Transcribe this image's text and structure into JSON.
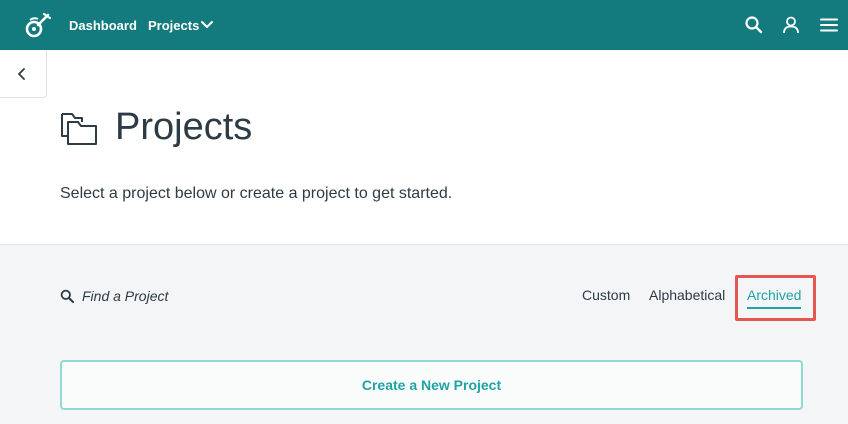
{
  "topbar": {
    "bg_color": "#137b7e",
    "logo_icon": "guitar-logo-icon",
    "dashboard_label": "Dashboard",
    "projects_label": "Projects"
  },
  "header": {
    "title": "Projects",
    "subtitle": "Select a project below or create a project to get started."
  },
  "search": {
    "placeholder": "Find a Project"
  },
  "sort_options": {
    "custom": "Custom",
    "alphabetical": "Alphabetical",
    "archived": "Archived",
    "active": "archived"
  },
  "create_button": {
    "label": "Create a New Project"
  },
  "colors": {
    "accent": "#1fa3a5",
    "highlight": "#e4564f"
  }
}
